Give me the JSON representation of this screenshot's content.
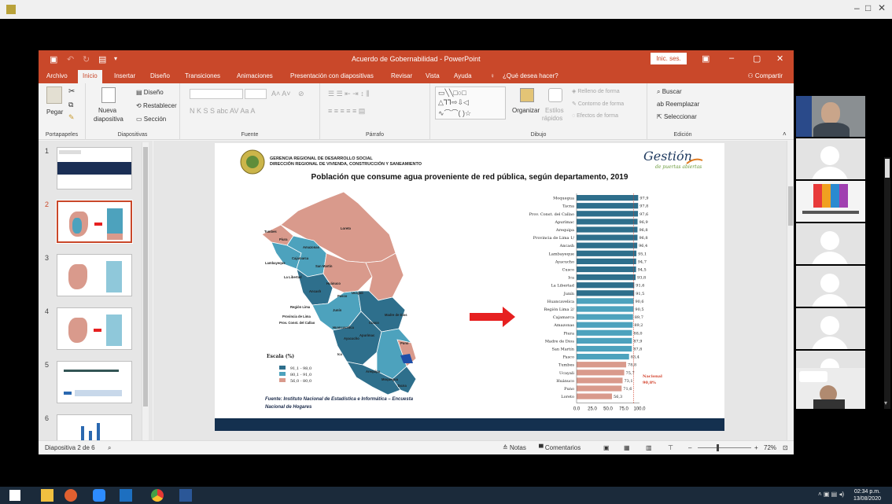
{
  "powerpoint": {
    "title": "Acuerdo de Gobernabilidad - PowerPoint",
    "signin": "Inic. ses.",
    "tabs": [
      "Archivo",
      "Inicio",
      "Insertar",
      "Diseño",
      "Transiciones",
      "Animaciones",
      "Presentación con diapositivas",
      "Revisar",
      "Vista",
      "Ayuda"
    ],
    "tell_me": "¿Qué desea hacer?",
    "share": "Compartir"
  },
  "ribbon": {
    "paste": "Pegar",
    "new_slide_1": "Nueva",
    "new_slide_2": "diapositiva",
    "layout": "Diseño",
    "reset": "Restablecer",
    "section": "Sección",
    "font_buttons": "N  K  S  S  abc  AV  Aa  A",
    "organize": "Organizar",
    "styles": "Estilos",
    "styles2": "rápidos",
    "shape_fill": "Relleno de forma",
    "shape_outline": "Contorno de forma",
    "shape_effects": "Efectos de forma",
    "find": "Buscar",
    "replace": "Reemplazar",
    "select": "Seleccionar",
    "groups": [
      "Portapapeles",
      "Diapositivas",
      "Fuente",
      "Párrafo",
      "Dibujo",
      "Edición"
    ]
  },
  "thumbnails": [
    "1",
    "2",
    "3",
    "4",
    "5",
    "6"
  ],
  "slide": {
    "header_line1": "GERENCIA REGIONAL DE DESARROLLO SOCIAL",
    "header_line2": "DIRECCIÓN REGIONAL DE VIVIENDA, CONSTRUCCIÓN Y SANEAMIENTO",
    "logo_word": "Gestión",
    "logo_sub": "de puertas abiertas",
    "title": "Población que consume agua proveniente de red pública, según departamento, 2019",
    "scale_title": "Escala (%)",
    "scale": [
      {
        "label": "91,1 - 98,0",
        "color": "#2e6f8c"
      },
      {
        "label": "80,1 - 91,0",
        "color": "#4da2bd"
      },
      {
        "label": "56,0 - 80,0",
        "color": "#d99a8c"
      }
    ],
    "map_labels": [
      "Tumbes",
      "Piura",
      "Loreto",
      "Lambayeque",
      "Cajamarca",
      "Amazonas",
      "San Martín",
      "La Libertad",
      "Ancash",
      "Huánuco",
      "Pasco",
      "Ucayali",
      "Región Lima",
      "Provincia de Lima",
      "Prov. Const. del Callao",
      "Junín",
      "Madre de Dios",
      "Huancavelica",
      "Cusco",
      "Ayacucho",
      "Apurímac",
      "Puno",
      "Ica",
      "Arequipa",
      "Moquegua",
      "Tacna"
    ],
    "source_line1": "Fuente: Instituto Nacional de Estadística e Informática – Encuesta",
    "source_line2": "Nacional de Hogares",
    "nacional_label": "Nacional",
    "nacional_value": "90,8%"
  },
  "chart_data": {
    "type": "bar",
    "orientation": "horizontal",
    "categories": [
      "Moquegua",
      "Tacna",
      "Prov. Const. del Callao",
      "Apurímac",
      "Arequipa",
      "Provincia de Lima 1/",
      "Ancash",
      "Lambayeque",
      "Ayacucho",
      "Cusco",
      "Ica",
      "La Libertad",
      "Junín",
      "Huancavelica",
      "Región Lima 2/",
      "Cajamarca",
      "Amazonas",
      "Piura",
      "Madre de Dios",
      "San Martín",
      "Pasco",
      "Tumbes",
      "Ucayali",
      "Huánuco",
      "Puno",
      "Loreto"
    ],
    "values": [
      97.9,
      97.8,
      97.6,
      96.9,
      96.8,
      96.8,
      96.4,
      95.1,
      94.7,
      94.5,
      93.8,
      91.6,
      91.5,
      90.6,
      90.5,
      89.7,
      89.2,
      88.0,
      87.9,
      87.8,
      83.4,
      78.8,
      75.7,
      73.1,
      71.6,
      56.3
    ],
    "value_labels": [
      "97,9",
      "97,8",
      "97,6",
      "96,9",
      "96,8",
      "96,8",
      "96,4",
      "95,1",
      "94,7",
      "94,5",
      "93,8",
      "91,6",
      "91,5",
      "90,6",
      "90,5",
      "89,7",
      "89,2",
      "88,0",
      "87,9",
      "87,8",
      "83,4",
      "78,8",
      "75,7",
      "73,1",
      "71,6",
      "56,3"
    ],
    "xticks": [
      "0.0",
      "25.0",
      "50.0",
      "75.0",
      "100.0"
    ],
    "xlim": [
      0,
      100
    ],
    "reference_line": 90.8,
    "colors": {
      "high": "#2e6f8c",
      "mid": "#4da2bd",
      "low": "#d99a8c"
    }
  },
  "statusbar": {
    "slide_info": "Diapositiva 2 de 6",
    "notes": "Notas",
    "comments": "Comentarios",
    "zoom": "72%"
  },
  "taskbar": {
    "time": "02:34 p.m.",
    "date": "13/08/2020"
  },
  "colors": {
    "accent": "#c9482a",
    "slide_footer": "#14304f",
    "arrow": "#e62020"
  }
}
